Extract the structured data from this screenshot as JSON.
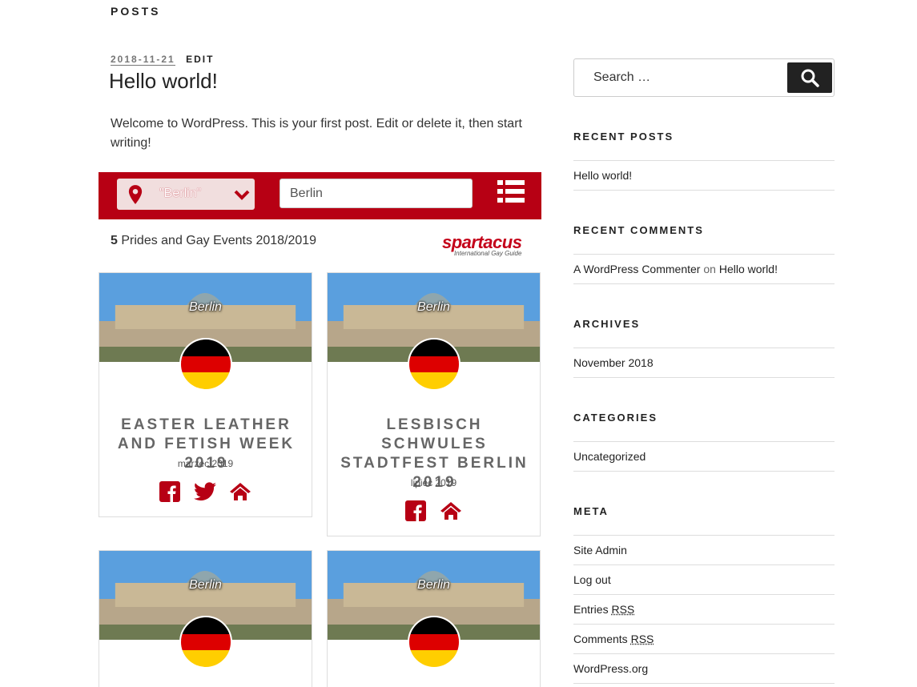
{
  "page": {
    "heading": "POSTS"
  },
  "post": {
    "date": "2018-11-21",
    "edit_label": "EDIT",
    "title": "Hello world!",
    "body": "Welcome to WordPress. This is your first post. Edit or delete it, then start writing!"
  },
  "widget": {
    "location_label": "\"Berlin\"",
    "search_value": "Berlin",
    "count": "5",
    "count_text": "Prides and Gay Events 2018/2019",
    "brand": "spartacus",
    "brand_tagline": "International Gay Guide",
    "colors": {
      "bar": "#b70014",
      "title": "#666666"
    },
    "events": [
      {
        "city": "Berlin",
        "title": "EASTER LEATHER AND FETISH WEEK 2019",
        "date": "marzec 2019",
        "icons": [
          "facebook-icon",
          "twitter-icon",
          "home-icon"
        ]
      },
      {
        "city": "Berlin",
        "title": "LESBISCH SCHWULES STADTFEST BERLIN 2019",
        "date": "lipiec 2019",
        "icons": [
          "facebook-icon",
          "home-icon"
        ]
      },
      {
        "city": "Berlin"
      },
      {
        "city": "Berlin"
      }
    ]
  },
  "sidebar": {
    "search_placeholder": "Search …",
    "search_button": "Search",
    "recent_posts": {
      "title": "RECENT POSTS",
      "items": [
        "Hello world!"
      ]
    },
    "recent_comments": {
      "title": "RECENT COMMENTS",
      "author": "A WordPress Commenter",
      "on": "on",
      "post": "Hello world!"
    },
    "archives": {
      "title": "ARCHIVES",
      "items": [
        "November 2018"
      ]
    },
    "categories": {
      "title": "CATEGORIES",
      "items": [
        "Uncategorized"
      ]
    },
    "meta": {
      "title": "META",
      "site_admin": "Site Admin",
      "log_out": "Log out",
      "entries": "Entries",
      "comments": "Comments",
      "rss": "RSS",
      "wordpress": "WordPress.org"
    }
  }
}
